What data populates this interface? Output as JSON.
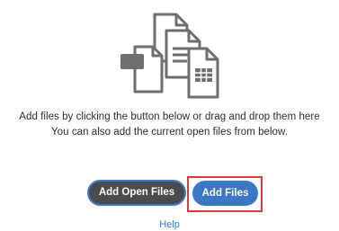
{
  "instructions": {
    "line1": "Add files by clicking the button below or drag and drop them here",
    "line2": "You can also add the current open files from below."
  },
  "buttons": {
    "add_open_files": "Add Open Files",
    "add_files": "Add Files"
  },
  "help": {
    "label": "Help"
  },
  "icons": {
    "illustration": "multiple-files-icon"
  },
  "colors": {
    "primary_blue": "#3a78c3",
    "dark_button": "#4b4b4b",
    "highlight_red": "#e03a3a",
    "icon_gray": "#6e6e6e"
  }
}
